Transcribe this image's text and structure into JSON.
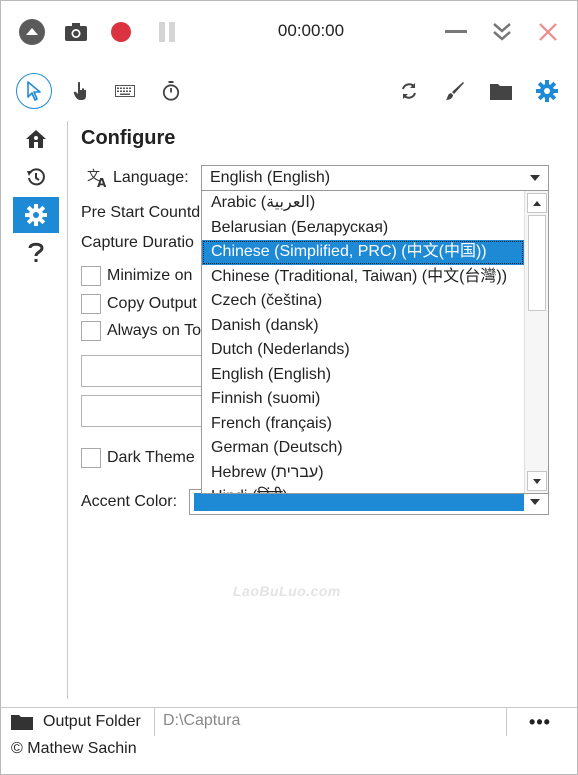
{
  "titlebar": {
    "timer": "00:00:00"
  },
  "config": {
    "heading": "Configure",
    "language_label": "Language:",
    "language_value": "English (English)",
    "pre_start_label": "Pre Start Countd",
    "capture_duration_label": "Capture Duratio",
    "minimize_label": "Minimize on",
    "copy_output_label": "Copy Output",
    "always_on_top_label": "Always on To",
    "dark_theme_label": "Dark Theme",
    "accent_color_label": "Accent Color:",
    "accent_color": "#1e8ad6"
  },
  "language_options": [
    "Arabic (العربية)",
    "Belarusian (Беларуская)",
    "Chinese (Simplified, PRC) (中文(中国))",
    "Chinese (Traditional, Taiwan) (中文(台灣))",
    "Czech (čeština)",
    "Danish (dansk)",
    "Dutch (Nederlands)",
    "English (English)",
    "Finnish (suomi)",
    "French (français)",
    "German (Deutsch)",
    "Hebrew (עברית)",
    "Hindi (हिंदी)"
  ],
  "selected_language_index": 2,
  "watermark": "LaoBuLuo.com",
  "footer": {
    "output_folder_label": "Output Folder",
    "output_path": "D:\\Captura",
    "more_label": "•••",
    "copyright": "© Mathew Sachin"
  },
  "icons": {
    "collapse": "chevron-up-circle-icon",
    "screenshot": "camera-icon",
    "record": "record-icon",
    "pause": "pause-icon",
    "minimize": "minimize-icon",
    "expand": "double-chevron-down-icon",
    "close": "close-icon",
    "cursor": "cursor-icon",
    "click": "hand-pointer-icon",
    "keystrokes": "keyboard-icon",
    "timer": "stopwatch-icon",
    "refresh": "refresh-icon",
    "brush": "brush-icon",
    "folder": "folder-icon",
    "settings": "gear-icon",
    "home": "home-icon",
    "history": "history-icon",
    "help": "help-icon"
  }
}
